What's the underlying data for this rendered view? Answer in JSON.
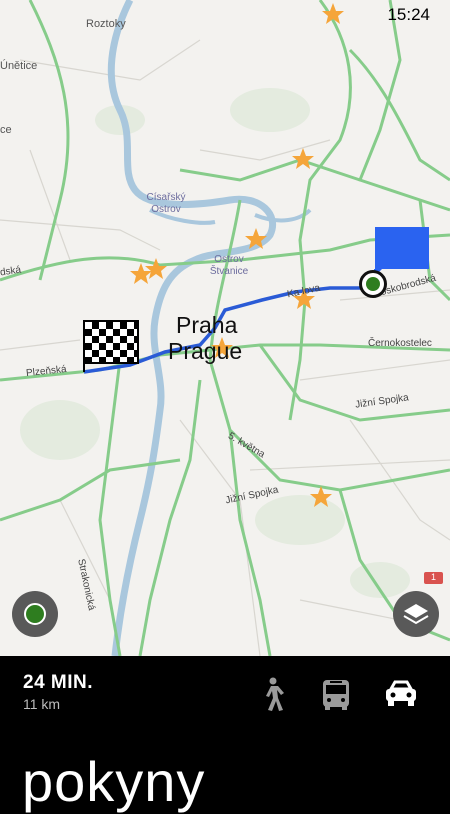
{
  "status": {
    "time": "15:24"
  },
  "map": {
    "places": {
      "roztoky": "Roztoky",
      "unetice": "Únětice",
      "ce": "ce",
      "cisarsky_ostrov": "Císařský Ostrov",
      "ostrov_stvanice": "Ostrov Štvanice",
      "praha": "Praha",
      "prague": "Prague"
    },
    "streets": {
      "karlinska": "Ka lova",
      "oskobrodska": "oskobrodská",
      "cernokostelec": "Černokostelec",
      "jizni_spojka_east": "Jižní Spojka",
      "jizni_spojka_south": "Jižní Spojka",
      "kvetna": "5. května",
      "plzenska": "Plzeňská",
      "strakonicka": "Strakonická",
      "dska": "dská",
      "road_shield": "1"
    }
  },
  "route": {
    "duration": "24 MIN.",
    "distance": "11 km",
    "instructions_label": "pokyny"
  },
  "transport_modes": [
    {
      "name": "walk",
      "icon": "walk-icon",
      "selected": false
    },
    {
      "name": "transit",
      "icon": "bus-icon",
      "selected": false
    },
    {
      "name": "car",
      "icon": "car-icon",
      "selected": true
    }
  ],
  "colors": {
    "route": "#2a5bd6",
    "major_road": "#86cc8a",
    "poi_star": "#f5a53a",
    "river": "#a9c7dd",
    "start_pin": "#2a63f0",
    "location_dot": "#2e7d1f",
    "panel_bg": "#000000"
  }
}
